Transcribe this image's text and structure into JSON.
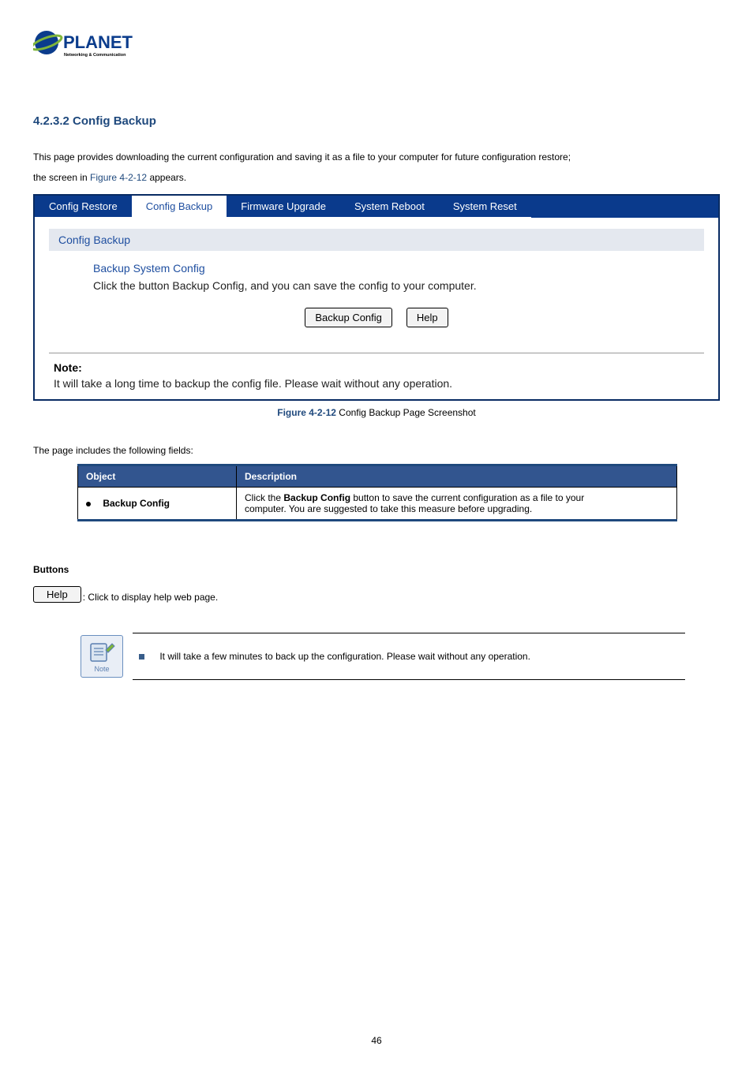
{
  "logo": {
    "brand_top": "PLANET",
    "brand_sub": "Networking & Communication"
  },
  "section_heading": "4.2.3.2 Config Backup",
  "intro": {
    "line1_pre": "This page provides downloading the current configuration and saving it as a file to your computer for future configuration restore;",
    "line2_pre": "the screen in ",
    "fig_ref": "Figure 4-2-12",
    "line2_post": " appears."
  },
  "tabs": {
    "t0": "Config Restore",
    "t1": "Config Backup",
    "t2": "Firmware Upgrade",
    "t3": "System Reboot",
    "t4": "System Reset"
  },
  "panel": {
    "subhead": "Config Backup",
    "title": "Backup System Config",
    "desc": "Click the button Backup Config, and you can save the config to your computer.",
    "btn_backup": "Backup Config",
    "btn_help": "Help",
    "note_title": "Note:",
    "note_text": "It will take a long time to backup the config file. Please wait without any operation."
  },
  "caption": {
    "prefix": "Figure 4-2-12",
    "text": " Config Backup Page Screenshot"
  },
  "fields_intro": "The page includes the following fields:",
  "fields_table": {
    "h_object": "Object",
    "h_desc": "Description",
    "row1_obj": "Backup Config",
    "row1_pre": "Click the ",
    "row1_btn": "Backup Config",
    "row1_mid": " button to save the current configuration as a file to your",
    "row1_cont": "computer. You are suggested to take this measure before upgrading."
  },
  "buttons_heading": "Buttons",
  "help_btn_label": "Help",
  "help_btn_desc": ": Click to display help web page.",
  "note_callout": {
    "icon_label": "Note",
    "text": "It will take a few minutes to back up the configuration. Please wait without any operation."
  },
  "page_number": "46"
}
